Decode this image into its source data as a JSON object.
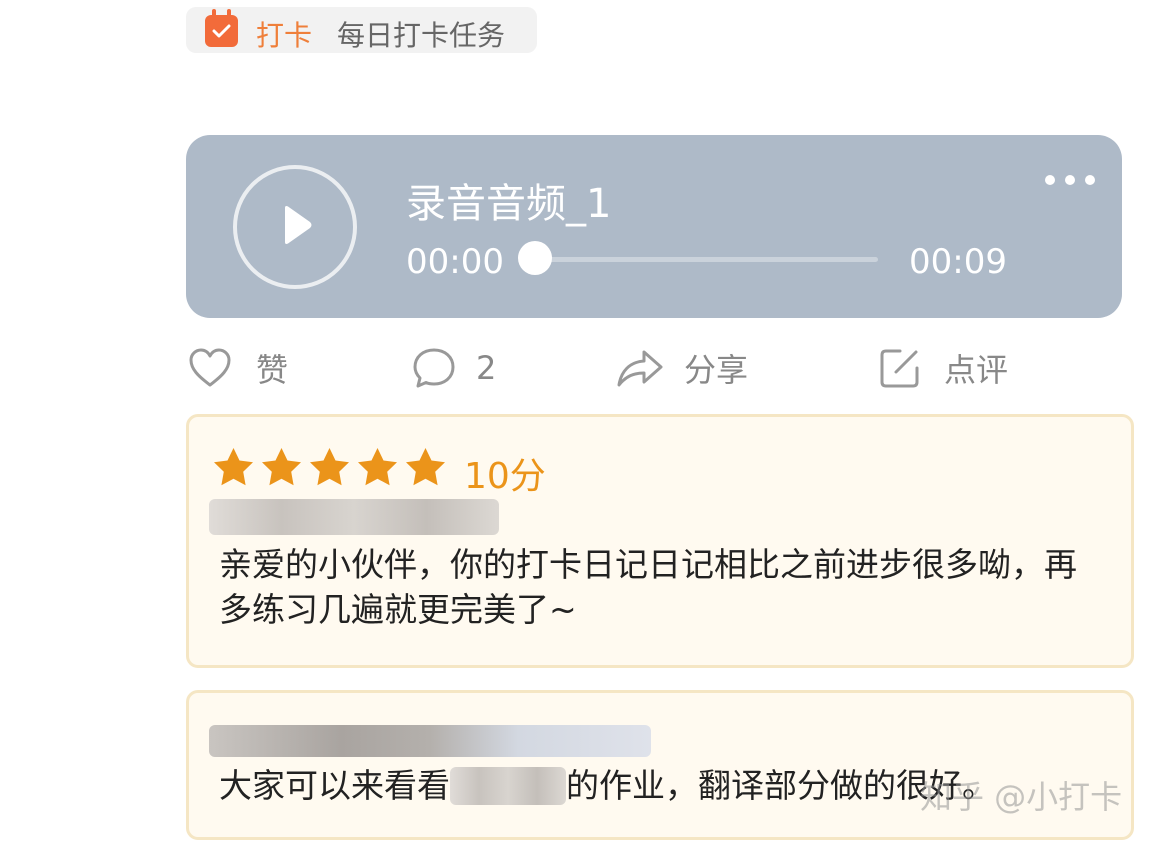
{
  "tag": {
    "label": "打卡",
    "description": "每日打卡任务",
    "icon": "calendar-check-icon",
    "color": "#f26b3a"
  },
  "audio": {
    "title": "录音音频_1",
    "current_time": "00:00",
    "total_time": "00:09",
    "progress": 0,
    "more_icon": "more-dots-icon",
    "background": "#aebac8"
  },
  "actions": {
    "like": {
      "label": "赞",
      "icon": "heart-icon"
    },
    "comment": {
      "label": "2",
      "icon": "comment-bubble-icon"
    },
    "share": {
      "label": "分享",
      "icon": "share-arrow-icon"
    },
    "review": {
      "label": "点评",
      "icon": "edit-note-icon"
    }
  },
  "review": {
    "stars": 5,
    "max_stars": 5,
    "score": "10分",
    "star_color": "#eb941a",
    "text": "亲爱的小伙伴，你的打卡日记日记相比之前进步很多呦，再多练习几遍就更完美了~"
  },
  "second_comment": {
    "text_before": "大家可以来看看",
    "text_after": "的作业，翻译部分做的很好。"
  },
  "watermark": "知乎 @小打卡"
}
